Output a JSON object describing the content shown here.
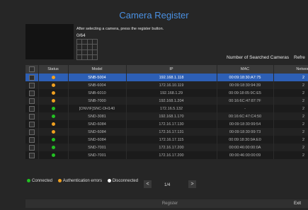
{
  "dialog": {
    "title": "Camera Register",
    "hint": "After selecting a camera, press the register button.",
    "selected_count": "0/64",
    "searched_label": "Number of Searched Cameras",
    "refresh_label": "Refre"
  },
  "table": {
    "headers": [
      "",
      "Status",
      "Model",
      "IP",
      "MAC",
      "Network"
    ],
    "rows": [
      {
        "status": "authentication-error",
        "model": "SNB-5004",
        "ip": "192.168.1.118",
        "mac": "00:09:18:30:A7:75",
        "network": "2",
        "selected": true
      },
      {
        "status": "authentication-error",
        "model": "SNB-6004",
        "ip": "172.16.10.119",
        "mac": "00:09:18:30:94:39",
        "network": "2"
      },
      {
        "status": "authentication-error",
        "model": "SNB-6010",
        "ip": "192.168.1.29",
        "mac": "00:09:18:05:9C:E5",
        "network": "2"
      },
      {
        "status": "authentication-error",
        "model": "SNB-7000",
        "ip": "192.168.1.204",
        "mac": "00:16:6C:47:87:7F",
        "network": "2"
      },
      {
        "status": "connected",
        "model": "[ONVIF]SNC-DH140",
        "ip": "172.16.5.132",
        "mac": "-",
        "network": "2"
      },
      {
        "status": "connected",
        "model": "SND-3081",
        "ip": "192.168.1.170",
        "mac": "00:16:6C:47:C4:50",
        "network": "2"
      },
      {
        "status": "authentication-error",
        "model": "SND-6084",
        "ip": "172.16.17.130",
        "mac": "00:09:18:30:99:54",
        "network": "2"
      },
      {
        "status": "authentication-error",
        "model": "SND-6084",
        "ip": "172.16.17.131",
        "mac": "00:09:18:30:99:73",
        "network": "2"
      },
      {
        "status": "connected",
        "model": "SND-6084",
        "ip": "172.16.17.115",
        "mac": "00:09:18:30:9A:E0",
        "network": "2"
      },
      {
        "status": "connected",
        "model": "SND-7001",
        "ip": "172.16.17.200",
        "mac": "00:00:46:00:00:0A",
        "network": "2"
      },
      {
        "status": "connected",
        "model": "SND-7001",
        "ip": "172.16.17.200",
        "mac": "00:00:46:00:00:09",
        "network": "2"
      }
    ]
  },
  "legend": {
    "connected": "Connected",
    "auth_error": "Authentication errors",
    "disconnected": "Disconnected"
  },
  "pager": {
    "prev": "<",
    "page": "1/4",
    "next": ">"
  },
  "buttons": {
    "register": "Register",
    "exit": "Exit"
  },
  "colors": {
    "connected": "#22c122",
    "authentication-error": "#f0a020",
    "disconnected": "#ffffff",
    "selected_row": "#2d5fb5",
    "title": "#4a90e2"
  }
}
